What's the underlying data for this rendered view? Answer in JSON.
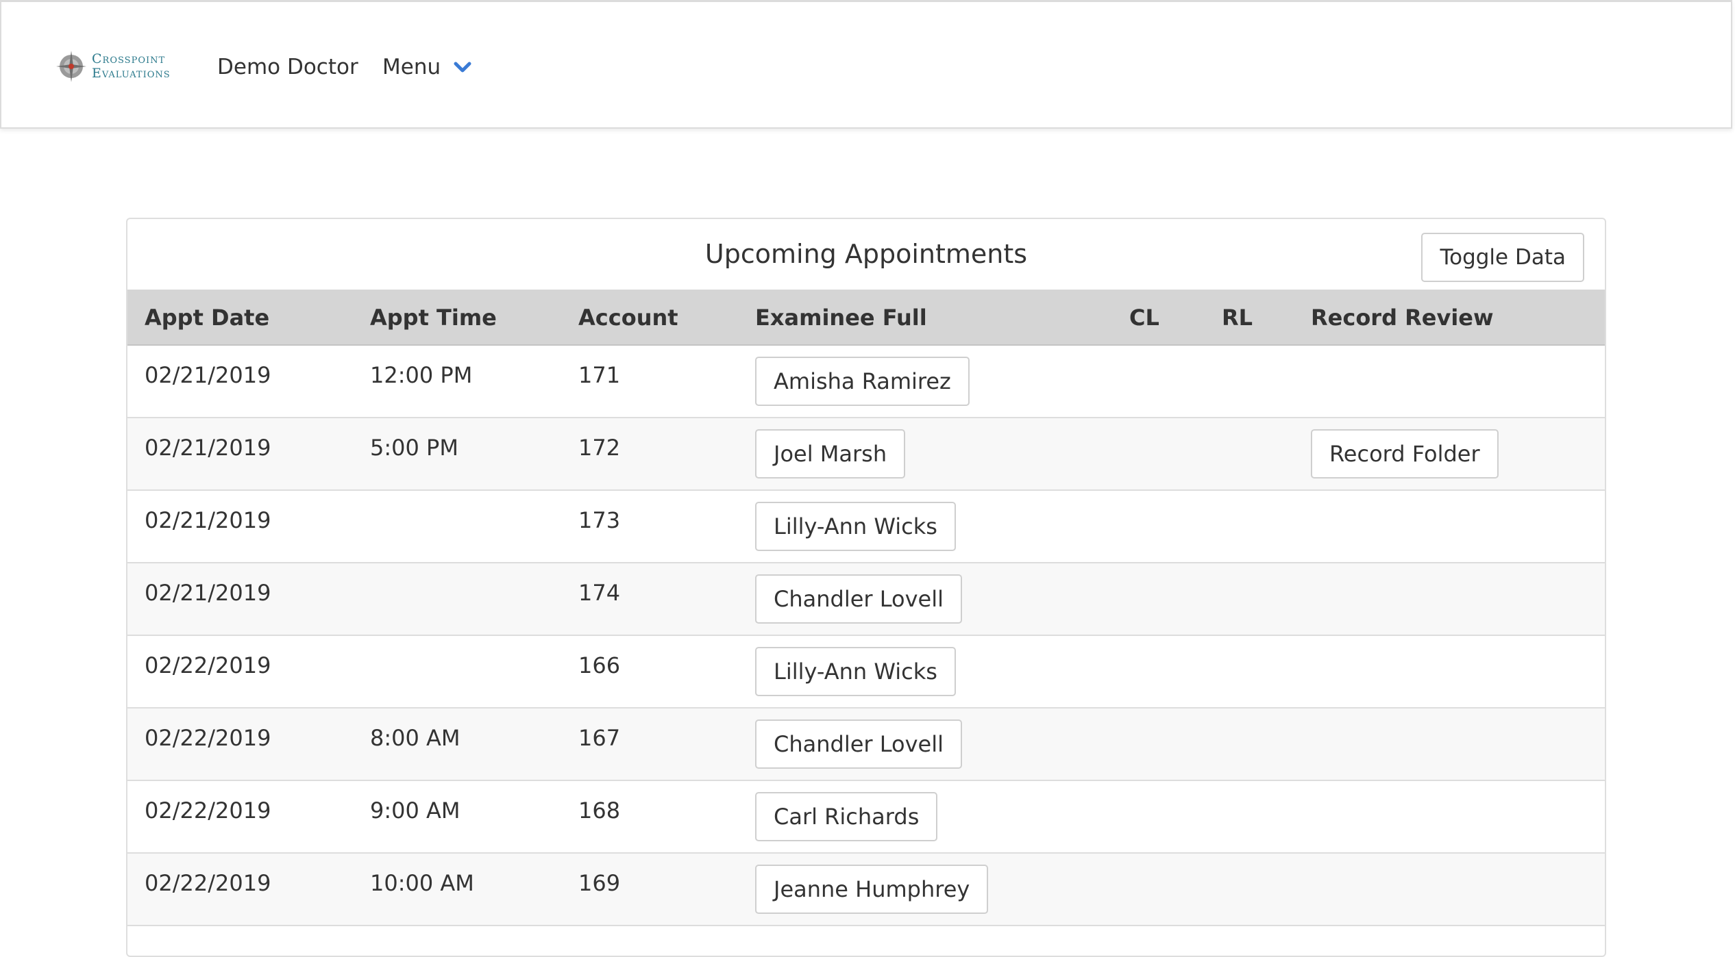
{
  "header": {
    "brand_line1": "Crosspoint",
    "brand_line2": "Evaluations",
    "user_name": "Demo Doctor",
    "menu_label": "Menu",
    "menu_icon": "chevron-down-icon",
    "accent_color": "#3a7bd5"
  },
  "panel": {
    "title": "Upcoming Appointments",
    "toggle_label": "Toggle Data"
  },
  "table": {
    "columns": [
      "Appt Date",
      "Appt Time",
      "Account",
      "Examinee Full",
      "CL",
      "RL",
      "Record Review"
    ],
    "rows": [
      {
        "date": "02/21/2019",
        "time": "12:00 PM",
        "account": "171",
        "examinee": "Amisha Ramirez",
        "cl": "",
        "rl": "",
        "review": ""
      },
      {
        "date": "02/21/2019",
        "time": "5:00 PM",
        "account": "172",
        "examinee": "Joel Marsh",
        "cl": "",
        "rl": "",
        "review": "Record Folder"
      },
      {
        "date": "02/21/2019",
        "time": "",
        "account": "173",
        "examinee": "Lilly-Ann Wicks",
        "cl": "",
        "rl": "",
        "review": ""
      },
      {
        "date": "02/21/2019",
        "time": "",
        "account": "174",
        "examinee": "Chandler Lovell",
        "cl": "",
        "rl": "",
        "review": ""
      },
      {
        "date": "02/22/2019",
        "time": "",
        "account": "166",
        "examinee": "Lilly-Ann Wicks",
        "cl": "",
        "rl": "",
        "review": ""
      },
      {
        "date": "02/22/2019",
        "time": "8:00 AM",
        "account": "167",
        "examinee": "Chandler Lovell",
        "cl": "",
        "rl": "",
        "review": ""
      },
      {
        "date": "02/22/2019",
        "time": "9:00 AM",
        "account": "168",
        "examinee": "Carl Richards",
        "cl": "",
        "rl": "",
        "review": ""
      },
      {
        "date": "02/22/2019",
        "time": "10:00 AM",
        "account": "169",
        "examinee": "Jeanne Humphrey",
        "cl": "",
        "rl": "",
        "review": ""
      }
    ]
  }
}
